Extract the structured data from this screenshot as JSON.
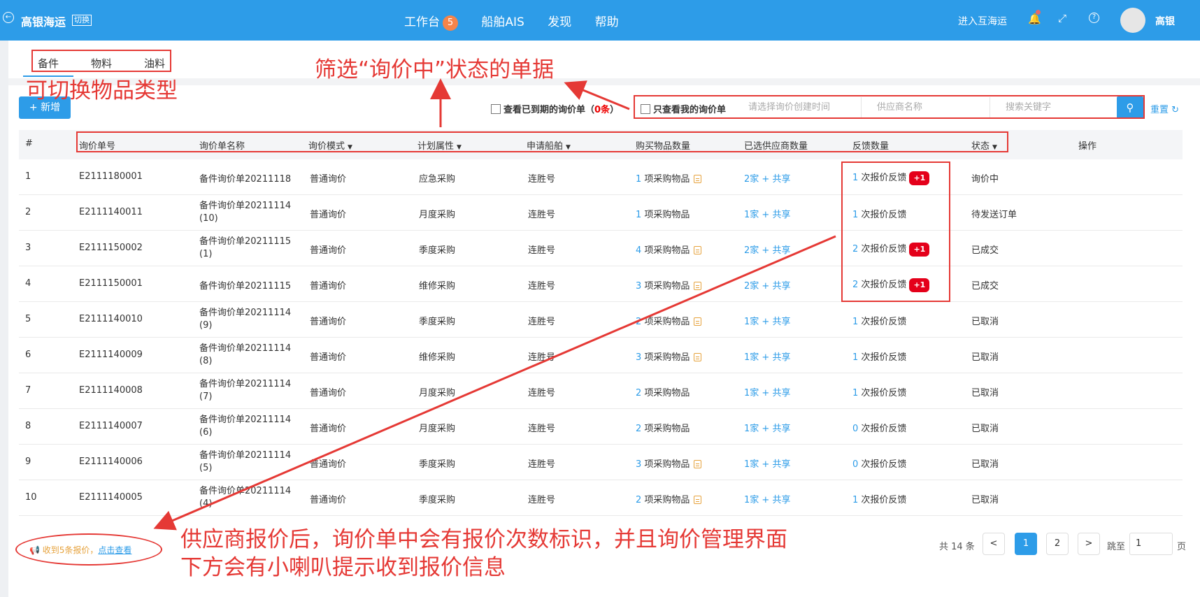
{
  "header": {
    "brand": "高银海运",
    "switch_label": "切换",
    "nav": [
      {
        "label": "工作台",
        "badge": "5"
      },
      {
        "label": "船舶AIS"
      },
      {
        "label": "发现"
      },
      {
        "label": "帮助"
      }
    ],
    "enter_link": "进入互海运",
    "username": "高银"
  },
  "tabs": [
    "备件",
    "物料",
    "油料"
  ],
  "toolbar": {
    "new_button": "新增",
    "expired_label_prefix": "查看已到期的询价单（",
    "expired_count": "0条",
    "expired_label_suffix": "）",
    "mine_label": "只查看我的询价单",
    "date_placeholder": "请选择询价创建时间",
    "supplier_placeholder": "供应商名称",
    "keyword_placeholder": "搜索关键字",
    "reset_label": "重置"
  },
  "table": {
    "columns": [
      "#",
      "询价单号",
      "询价单名称",
      "询价模式",
      "计划属性",
      "申请船舶",
      "购买物品数量",
      "已选供应商数量",
      "反馈数量",
      "状态",
      "操作"
    ],
    "rows": [
      {
        "no": "1",
        "code": "E2111180001",
        "name1": "备件询价单20211118",
        "name2": "",
        "mode": "普通询价",
        "plan": "应急采购",
        "ship": "连胜号",
        "items_n": "1",
        "items_t": "项采购物品",
        "doc": true,
        "sup_n": "2家",
        "sup_t": "+ 共享",
        "fb_n": "1",
        "fb_t": "次报价反馈",
        "fb_badge": "+1",
        "status": "询价中"
      },
      {
        "no": "2",
        "code": "E2111140011",
        "name1": "备件询价单20211114",
        "name2": "(10)",
        "mode": "普通询价",
        "plan": "月度采购",
        "ship": "连胜号",
        "items_n": "1",
        "items_t": "项采购物品",
        "doc": false,
        "sup_n": "1家",
        "sup_t": "+ 共享",
        "fb_n": "1",
        "fb_t": "次报价反馈",
        "fb_badge": "",
        "status": "待发送订单"
      },
      {
        "no": "3",
        "code": "E2111150002",
        "name1": "备件询价单20211115",
        "name2": "(1)",
        "mode": "普通询价",
        "plan": "季度采购",
        "ship": "连胜号",
        "items_n": "4",
        "items_t": "项采购物品",
        "doc": true,
        "sup_n": "2家",
        "sup_t": "+ 共享",
        "fb_n": "2",
        "fb_t": "次报价反馈",
        "fb_badge": "+1",
        "status": "已成交"
      },
      {
        "no": "4",
        "code": "E2111150001",
        "name1": "备件询价单20211115",
        "name2": "",
        "mode": "普通询价",
        "plan": "维修采购",
        "ship": "连胜号",
        "items_n": "3",
        "items_t": "项采购物品",
        "doc": true,
        "sup_n": "2家",
        "sup_t": "+ 共享",
        "fb_n": "2",
        "fb_t": "次报价反馈",
        "fb_badge": "+1",
        "status": "已成交"
      },
      {
        "no": "5",
        "code": "E2111140010",
        "name1": "备件询价单20211114",
        "name2": "(9)",
        "mode": "普通询价",
        "plan": "季度采购",
        "ship": "连胜号",
        "items_n": "2",
        "items_t": "项采购物品",
        "doc": true,
        "sup_n": "1家",
        "sup_t": "+ 共享",
        "fb_n": "1",
        "fb_t": "次报价反馈",
        "fb_badge": "",
        "status": "已取消"
      },
      {
        "no": "6",
        "code": "E2111140009",
        "name1": "备件询价单20211114",
        "name2": "(8)",
        "mode": "普通询价",
        "plan": "维修采购",
        "ship": "连胜号",
        "items_n": "3",
        "items_t": "项采购物品",
        "doc": true,
        "sup_n": "1家",
        "sup_t": "+ 共享",
        "fb_n": "1",
        "fb_t": "次报价反馈",
        "fb_badge": "",
        "status": "已取消"
      },
      {
        "no": "7",
        "code": "E2111140008",
        "name1": "备件询价单20211114",
        "name2": "(7)",
        "mode": "普通询价",
        "plan": "月度采购",
        "ship": "连胜号",
        "items_n": "2",
        "items_t": "项采购物品",
        "doc": false,
        "sup_n": "1家",
        "sup_t": "+ 共享",
        "fb_n": "1",
        "fb_t": "次报价反馈",
        "fb_badge": "",
        "status": "已取消"
      },
      {
        "no": "8",
        "code": "E2111140007",
        "name1": "备件询价单20211114",
        "name2": "(6)",
        "mode": "普通询价",
        "plan": "月度采购",
        "ship": "连胜号",
        "items_n": "2",
        "items_t": "项采购物品",
        "doc": false,
        "sup_n": "1家",
        "sup_t": "+ 共享",
        "fb_n": "0",
        "fb_t": "次报价反馈",
        "fb_badge": "",
        "status": "已取消"
      },
      {
        "no": "9",
        "code": "E2111140006",
        "name1": "备件询价单20211114",
        "name2": "(5)",
        "mode": "普通询价",
        "plan": "季度采购",
        "ship": "连胜号",
        "items_n": "3",
        "items_t": "项采购物品",
        "doc": true,
        "sup_n": "1家",
        "sup_t": "+ 共享",
        "fb_n": "0",
        "fb_t": "次报价反馈",
        "fb_badge": "",
        "status": "已取消"
      },
      {
        "no": "10",
        "code": "E2111140005",
        "name1": "备件询价单20211114",
        "name2": "(4)",
        "mode": "普通询价",
        "plan": "季度采购",
        "ship": "连胜号",
        "items_n": "2",
        "items_t": "项采购物品",
        "doc": true,
        "sup_n": "1家",
        "sup_t": "+ 共享",
        "fb_n": "1",
        "fb_t": "次报价反馈",
        "fb_badge": "",
        "status": "已取消"
      }
    ]
  },
  "notice": {
    "text": "收到5条报价，",
    "link": "点击查看"
  },
  "pagination": {
    "total": "共 14 条",
    "prev": "<",
    "pages": [
      "1",
      "2"
    ],
    "next": ">",
    "goto": "跳至",
    "goto_value": "1",
    "page_unit": "页"
  },
  "annotations": {
    "switch_type": "可切换物品类型",
    "filter_status": "筛选“询价中”状态的单据",
    "quote_line1": "供应商报价后，询价单中会有报价次数标识，并且询价管理界面",
    "quote_line2": "下方会有小喇叭提示收到报价信息"
  },
  "colors": {
    "primary": "#2d9ce8",
    "annotation": "#e53935",
    "badge": "#e4001a",
    "nav_badge": "#f5844a"
  }
}
